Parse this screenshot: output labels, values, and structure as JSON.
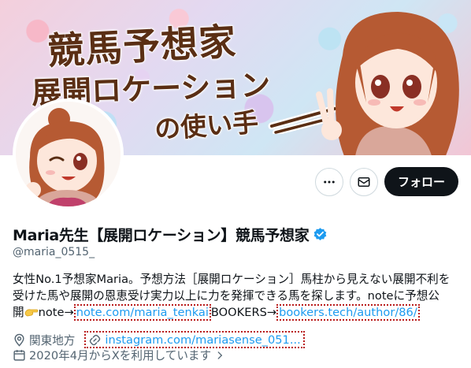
{
  "banner": {
    "line1": "競馬予想家",
    "line2": "展開ロケーション",
    "line3": "の使い手"
  },
  "actions": {
    "more_icon": "more-horizontal-icon",
    "message_icon": "envelope-icon",
    "follow_label": "フォロー"
  },
  "profile": {
    "display_name": "Maria先生【展開ロケーション】競馬予想家",
    "handle": "@maria_0515_",
    "verified_color": "#1d9bf0",
    "bio": {
      "line1": "女性No.1予想家Maria。予想方法［展開ロケーション］馬柱から見えない展開不利を",
      "line2": "受けた馬や展開の恩恵受け実力以上に力を発揮できる馬を探します。noteに予想公",
      "line3_prefix": "開",
      "line3_note": "note→",
      "note_link": "note.com/maria_tenkai",
      "bookers_text": "BOOKERS→",
      "bookers_link": "bookers.tech/author/86/"
    },
    "location": "関東地方",
    "website": "instagram.com/mariasense_051...",
    "joined": "2020年4月からXを利用しています"
  },
  "colors": {
    "link": "#1d9bf0",
    "follow_bg": "#0f1419",
    "annotation_dots": "#b91c1c"
  }
}
